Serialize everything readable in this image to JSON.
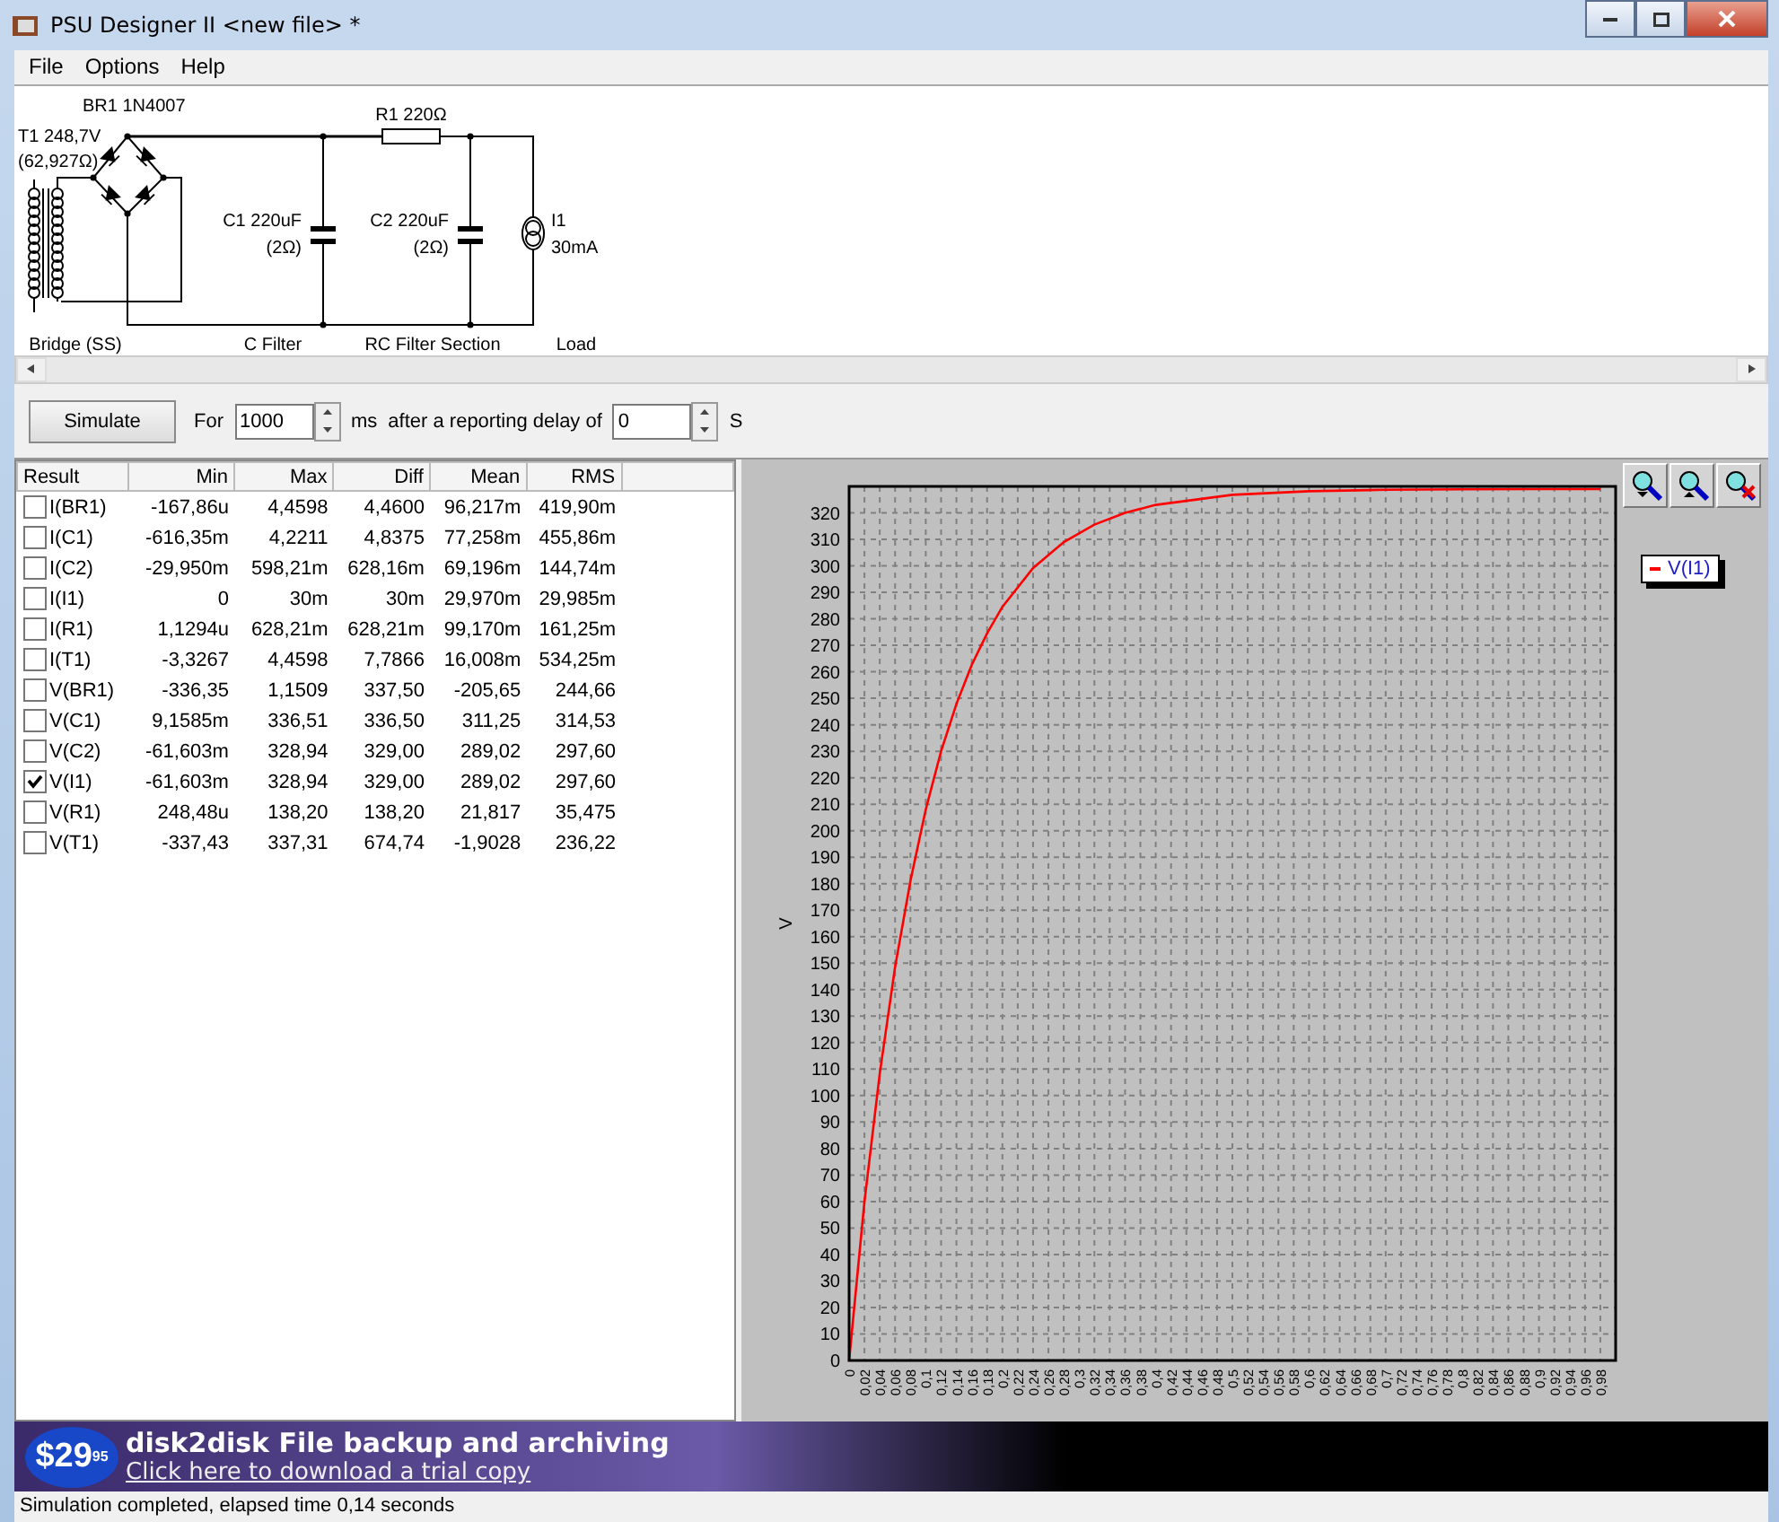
{
  "window": {
    "title": "PSU Designer II  <new file> *"
  },
  "menu": [
    "File",
    "Options",
    "Help"
  ],
  "schematic": {
    "components": [
      {
        "kind": "transformer",
        "label": [
          "T1 248,7V",
          "(62,927Ω)"
        ]
      },
      {
        "kind": "bridge",
        "label": [
          "BR1 1N4007"
        ]
      },
      {
        "kind": "capacitor",
        "label": [
          "C1 220uF",
          "(2Ω)"
        ]
      },
      {
        "kind": "resistor",
        "label": [
          "R1 220Ω"
        ]
      },
      {
        "kind": "capacitor",
        "label": [
          "C2 220uF",
          "(2Ω)"
        ]
      },
      {
        "kind": "current_source",
        "label": [
          "I1",
          "30mA"
        ]
      }
    ],
    "sections": [
      "Bridge (SS)",
      "C Filter",
      "RC Filter Section",
      "Load"
    ]
  },
  "simulation": {
    "button": "Simulate",
    "for_label": "For",
    "duration": "1000",
    "unit": "ms",
    "delay_label": "after a reporting delay of",
    "delay": "0",
    "delay_unit": "S"
  },
  "results": {
    "columns": [
      "Result",
      "Min",
      "Max",
      "Diff",
      "Mean",
      "RMS"
    ],
    "rows": [
      {
        "name": "I(BR1)",
        "checked": false,
        "values": [
          "-167,86u",
          "4,4598",
          "4,4600",
          "96,217m",
          "419,90m"
        ]
      },
      {
        "name": "I(C1)",
        "checked": false,
        "values": [
          "-616,35m",
          "4,2211",
          "4,8375",
          "77,258m",
          "455,86m"
        ]
      },
      {
        "name": "I(C2)",
        "checked": false,
        "values": [
          "-29,950m",
          "598,21m",
          "628,16m",
          "69,196m",
          "144,74m"
        ]
      },
      {
        "name": "I(I1)",
        "checked": false,
        "values": [
          "0",
          "30m",
          "30m",
          "29,970m",
          "29,985m"
        ]
      },
      {
        "name": "I(R1)",
        "checked": false,
        "values": [
          "1,1294u",
          "628,21m",
          "628,21m",
          "99,170m",
          "161,25m"
        ]
      },
      {
        "name": "I(T1)",
        "checked": false,
        "values": [
          "-3,3267",
          "4,4598",
          "7,7866",
          "16,008m",
          "534,25m"
        ]
      },
      {
        "name": "V(BR1)",
        "checked": false,
        "values": [
          "-336,35",
          "1,1509",
          "337,50",
          "-205,65",
          "244,66"
        ]
      },
      {
        "name": "V(C1)",
        "checked": false,
        "values": [
          "9,1585m",
          "336,51",
          "336,50",
          "311,25",
          "314,53"
        ]
      },
      {
        "name": "V(C2)",
        "checked": false,
        "values": [
          "-61,603m",
          "328,94",
          "329,00",
          "289,02",
          "297,60"
        ]
      },
      {
        "name": "V(I1)",
        "checked": true,
        "values": [
          "-61,603m",
          "328,94",
          "329,00",
          "289,02",
          "297,60"
        ]
      },
      {
        "name": "V(R1)",
        "checked": false,
        "values": [
          "248,48u",
          "138,20",
          "138,20",
          "21,817",
          "35,475"
        ]
      },
      {
        "name": "V(T1)",
        "checked": false,
        "values": [
          "-337,43",
          "337,31",
          "674,74",
          "-1,9028",
          "236,22"
        ]
      }
    ]
  },
  "plot": {
    "chart_data": {
      "type": "line",
      "ylabel": "V",
      "grid": true,
      "x": [
        0,
        0.02,
        0.04,
        0.06,
        0.08,
        0.1,
        0.12,
        0.14,
        0.16,
        0.18,
        0.2,
        0.24,
        0.28,
        0.32,
        0.36,
        0.4,
        0.5,
        0.6,
        0.7,
        0.8,
        0.9,
        0.98
      ],
      "series": [
        {
          "name": "V(I1)",
          "color": "#ff0000",
          "values": [
            0,
            59.6,
            108.5,
            148.5,
            181.2,
            208,
            229.9,
            247.9,
            262.6,
            274.6,
            284.5,
            299.2,
            309,
            315.6,
            320,
            323,
            326.8,
            328.2,
            328.7,
            328.9,
            329,
            329
          ]
        }
      ],
      "xlim": [
        0,
        1
      ],
      "ylim": [
        0,
        330
      ],
      "yticks": [
        0,
        10,
        20,
        30,
        40,
        50,
        60,
        70,
        80,
        90,
        100,
        110,
        120,
        130,
        140,
        150,
        160,
        170,
        180,
        190,
        200,
        210,
        220,
        230,
        240,
        250,
        260,
        270,
        280,
        290,
        300,
        310,
        320
      ],
      "xticks": [
        {
          "value": 0,
          "label": "0"
        },
        {
          "value": 0.02,
          "label": "0,02"
        },
        {
          "value": 0.04,
          "label": "0,04"
        },
        {
          "value": 0.06,
          "label": "0,06"
        },
        {
          "value": 0.08,
          "label": "0,08"
        },
        {
          "value": 0.1,
          "label": "0,1"
        },
        {
          "value": 0.12,
          "label": "0,12"
        },
        {
          "value": 0.14,
          "label": "0,14"
        },
        {
          "value": 0.16,
          "label": "0,16"
        },
        {
          "value": 0.18,
          "label": "0,18"
        },
        {
          "value": 0.2,
          "label": "0,2"
        },
        {
          "value": 0.22,
          "label": "0,22"
        },
        {
          "value": 0.24,
          "label": "0,24"
        },
        {
          "value": 0.26,
          "label": "0,26"
        },
        {
          "value": 0.28,
          "label": "0,28"
        },
        {
          "value": 0.3,
          "label": "0,3"
        },
        {
          "value": 0.32,
          "label": "0,32"
        },
        {
          "value": 0.34,
          "label": "0,34"
        },
        {
          "value": 0.36,
          "label": "0,36"
        },
        {
          "value": 0.38,
          "label": "0,38"
        },
        {
          "value": 0.4,
          "label": "0,4"
        },
        {
          "value": 0.42,
          "label": "0,42"
        },
        {
          "value": 0.44,
          "label": "0,44"
        },
        {
          "value": 0.46,
          "label": "0,46"
        },
        {
          "value": 0.48,
          "label": "0,48"
        },
        {
          "value": 0.5,
          "label": "0,5"
        },
        {
          "value": 0.52,
          "label": "0,52"
        },
        {
          "value": 0.54,
          "label": "0,54"
        },
        {
          "value": 0.56,
          "label": "0,56"
        },
        {
          "value": 0.58,
          "label": "0,58"
        },
        {
          "value": 0.6,
          "label": "0,6"
        },
        {
          "value": 0.62,
          "label": "0,62"
        },
        {
          "value": 0.64,
          "label": "0,64"
        },
        {
          "value": 0.66,
          "label": "0,66"
        },
        {
          "value": 0.68,
          "label": "0,68"
        },
        {
          "value": 0.7,
          "label": "0,7"
        },
        {
          "value": 0.72,
          "label": "0,72"
        },
        {
          "value": 0.74,
          "label": "0,74"
        },
        {
          "value": 0.76,
          "label": "0,76"
        },
        {
          "value": 0.78,
          "label": "0,78"
        },
        {
          "value": 0.8,
          "label": "0,8"
        },
        {
          "value": 0.82,
          "label": "0,82"
        },
        {
          "value": 0.84,
          "label": "0,84"
        },
        {
          "value": 0.86,
          "label": "0,86"
        },
        {
          "value": 0.88,
          "label": "0,88"
        },
        {
          "value": 0.9,
          "label": "0,9"
        },
        {
          "value": 0.92,
          "label": "0,92"
        },
        {
          "value": 0.94,
          "label": "0,94"
        },
        {
          "value": 0.96,
          "label": "0,96"
        },
        {
          "value": 0.98,
          "label": "0,98"
        }
      ]
    }
  },
  "ad": {
    "price": "$29",
    "cents": "95",
    "title": "disk2disk File backup and archiving",
    "link": "Click here to download a trial copy"
  },
  "status_bar": {
    "text": "Simulation completed, elapsed time 0,14 seconds"
  }
}
